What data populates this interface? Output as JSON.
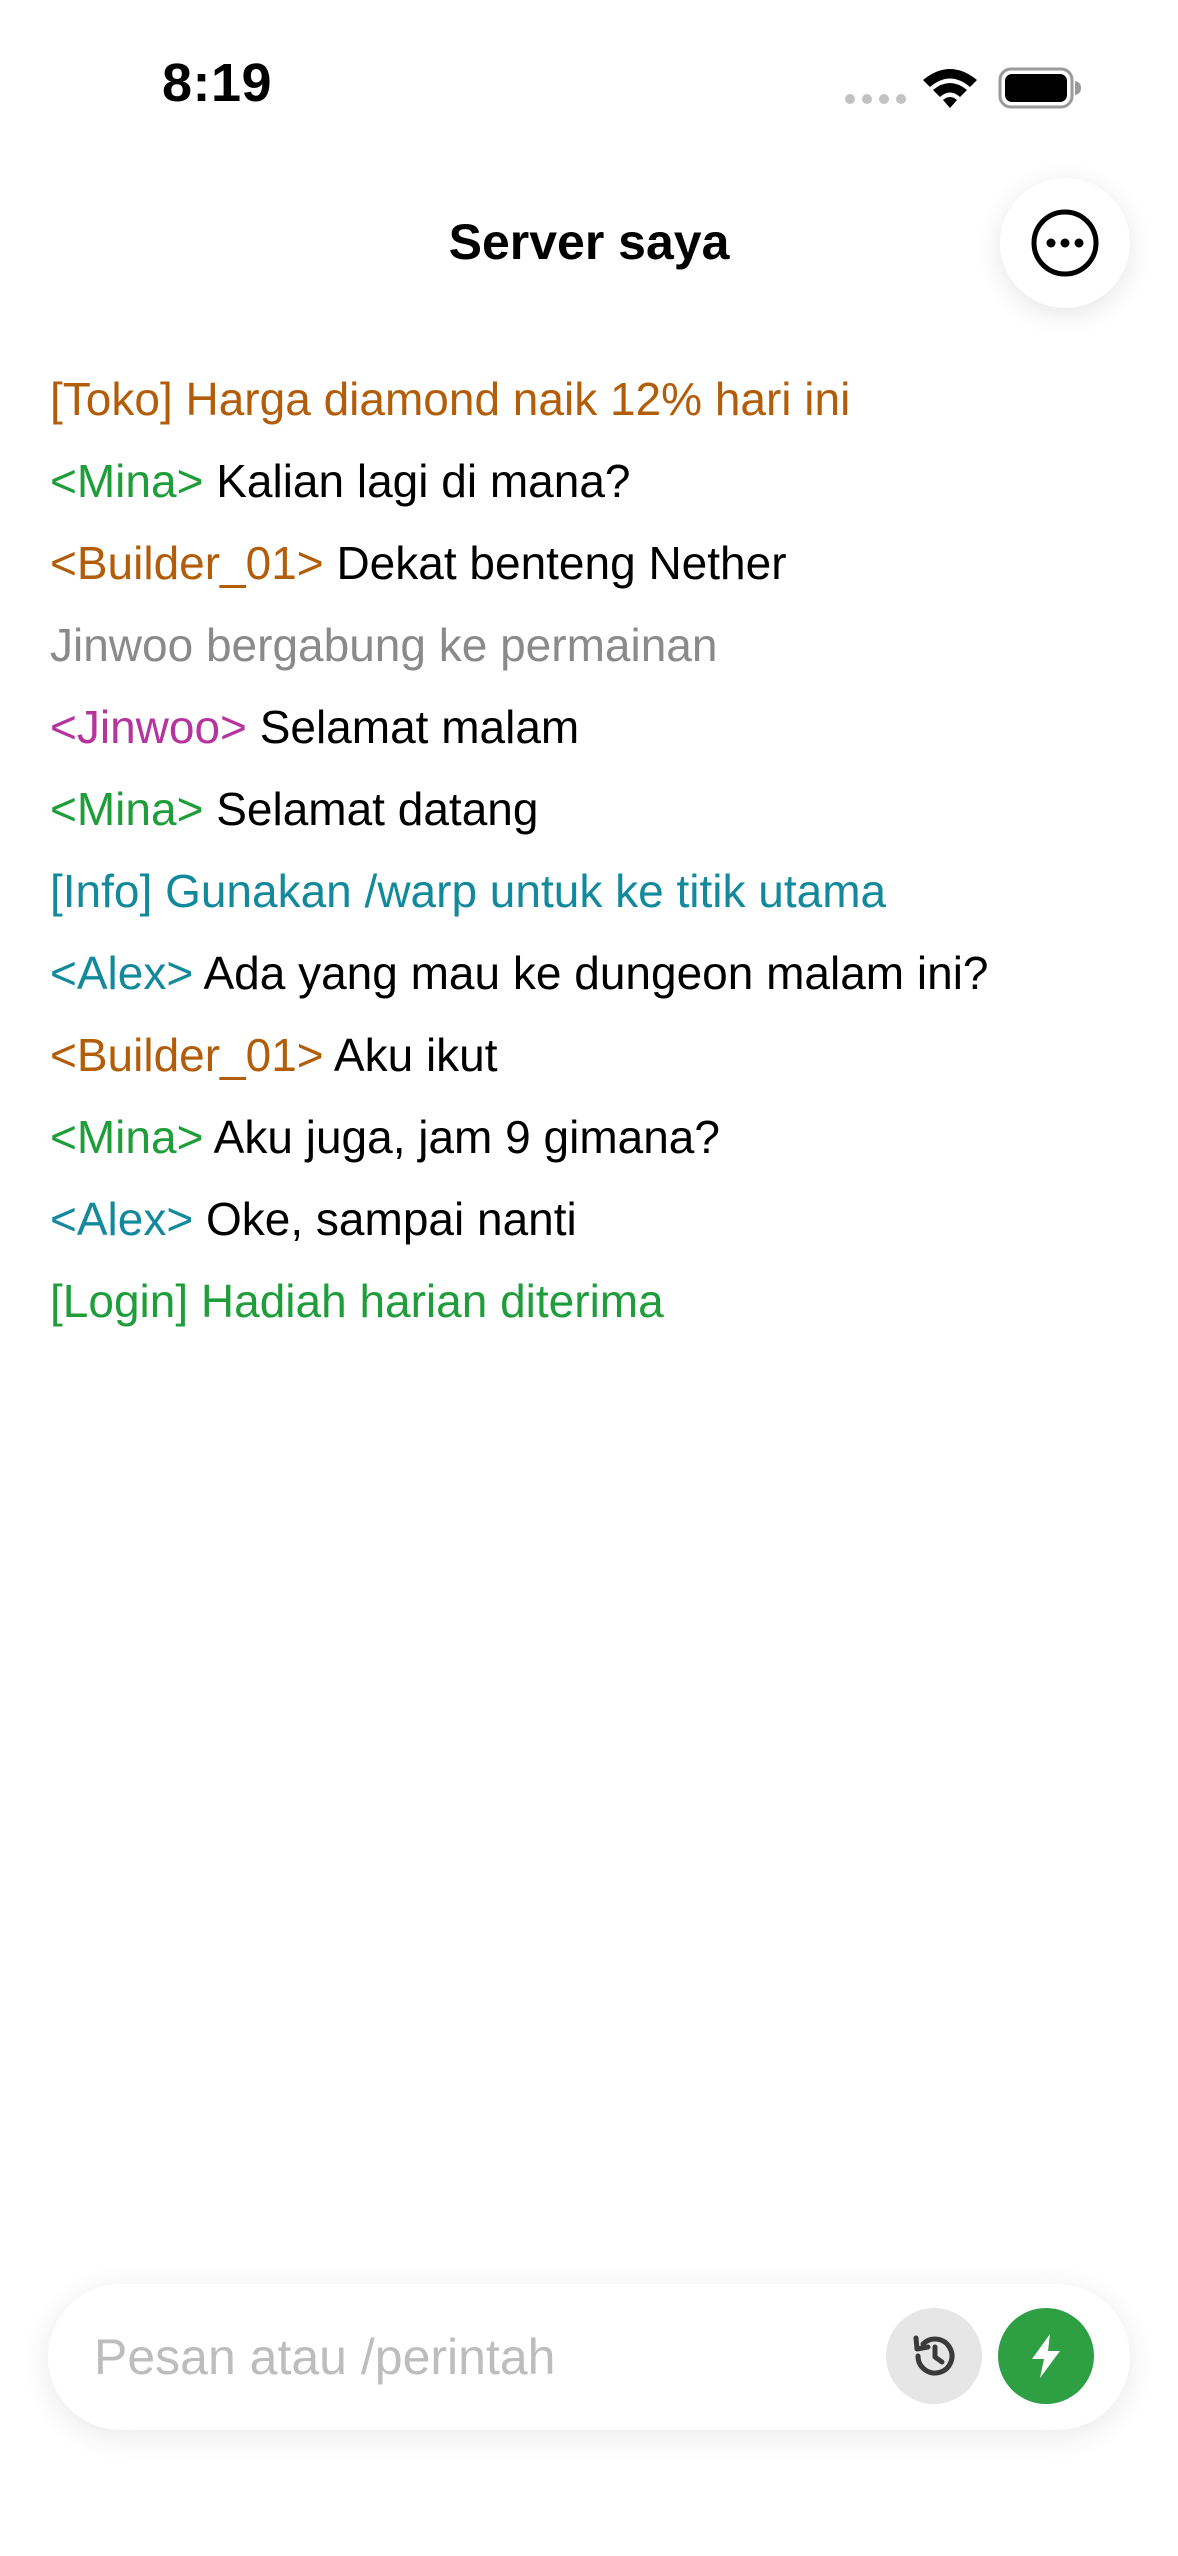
{
  "status_bar": {
    "time": "8:19"
  },
  "header": {
    "title": "Server saya",
    "more_icon": "ellipsis-circle-icon"
  },
  "colors": {
    "orange": "#b25d0a",
    "green": "#1f9d3b",
    "gray": "#8a8a8a",
    "magenta": "#b5359e",
    "teal": "#138a9c",
    "black": "#000000",
    "accent": "#2ea043"
  },
  "chat": {
    "messages": [
      {
        "prefix": "[Toko] Harga diamond naik 12% hari ini",
        "text": "",
        "color": "#b25d0a"
      },
      {
        "prefix": "<Mina>",
        "text": " Kalian lagi di mana?",
        "color": "#1f9d3b"
      },
      {
        "prefix": "<Builder_01>",
        "text": " Dekat benteng Nether",
        "color": "#b25d0a"
      },
      {
        "prefix": "Jinwoo bergabung ke permainan",
        "text": "",
        "color": "#8a8a8a"
      },
      {
        "prefix": "<Jinwoo>",
        "text": " Selamat malam",
        "color": "#b5359e"
      },
      {
        "prefix": "<Mina>",
        "text": " Selamat datang",
        "color": "#1f9d3b"
      },
      {
        "prefix": "[Info] Gunakan /warp untuk ke titik utama",
        "text": "",
        "color": "#138a9c"
      },
      {
        "prefix": "<Alex>",
        "text": " Ada yang mau ke dungeon malam ini?",
        "color": "#138a9c"
      },
      {
        "prefix": "<Builder_01>",
        "text": " Aku ikut",
        "color": "#b25d0a"
      },
      {
        "prefix": "<Mina>",
        "text": " Aku juga, jam 9 gimana?",
        "color": "#1f9d3b"
      },
      {
        "prefix": "<Alex>",
        "text": " Oke, sampai nanti",
        "color": "#138a9c"
      },
      {
        "prefix": "[Login] Hadiah harian diterima",
        "text": "",
        "color": "#1f9d3b"
      }
    ]
  },
  "composer": {
    "placeholder": "Pesan atau /perintah",
    "value": "",
    "history_icon": "history-icon",
    "send_icon": "bolt-icon"
  }
}
